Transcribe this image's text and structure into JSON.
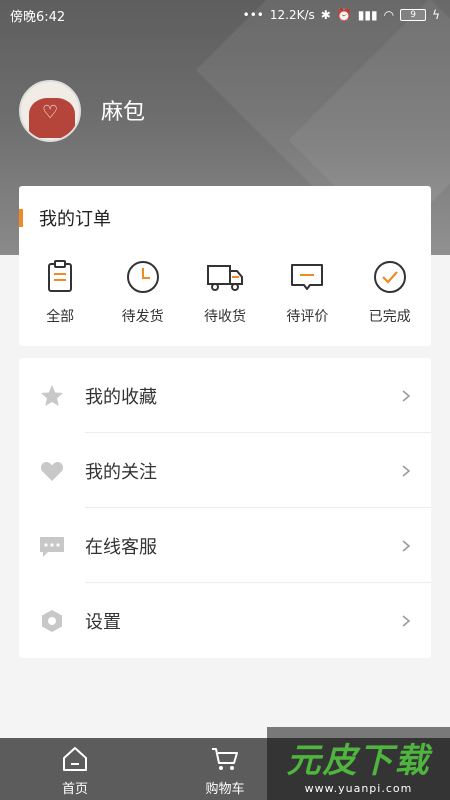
{
  "status_bar": {
    "time": "傍晚6:42",
    "net_speed": "12.2K/s",
    "battery": "9"
  },
  "profile": {
    "username": "麻包"
  },
  "orders": {
    "title": "我的订单",
    "accent_color": "#f08a24",
    "items": [
      {
        "label": "全部",
        "icon": "clipboard-icon"
      },
      {
        "label": "待发货",
        "icon": "clock-icon"
      },
      {
        "label": "待收货",
        "icon": "truck-icon"
      },
      {
        "label": "待评价",
        "icon": "comment-icon"
      },
      {
        "label": "已完成",
        "icon": "check-circle-icon"
      }
    ]
  },
  "menu": {
    "items": [
      {
        "label": "我的收藏",
        "icon": "star-icon"
      },
      {
        "label": "我的关注",
        "icon": "heart-icon"
      },
      {
        "label": "在线客服",
        "icon": "chat-icon"
      },
      {
        "label": "设置",
        "icon": "hexagon-icon"
      }
    ]
  },
  "tabbar": {
    "tabs": [
      {
        "label": "首页",
        "icon": "home-icon"
      },
      {
        "label": "购物车",
        "icon": "cart-icon"
      }
    ]
  },
  "watermark": {
    "title": "元皮下载",
    "url": "www.yuanpi.com"
  }
}
